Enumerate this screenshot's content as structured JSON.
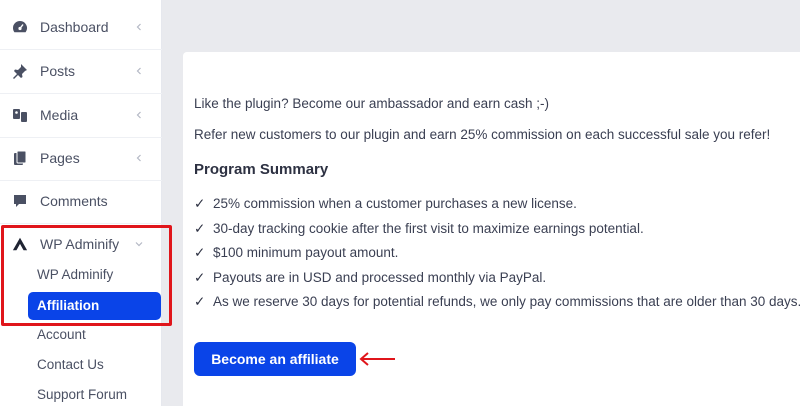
{
  "sidebar": {
    "items": [
      {
        "label": "Dashboard",
        "icon": "dashboard-icon"
      },
      {
        "label": "Posts",
        "icon": "pushpin-icon"
      },
      {
        "label": "Media",
        "icon": "media-icon"
      },
      {
        "label": "Pages",
        "icon": "pages-icon"
      },
      {
        "label": "Comments",
        "icon": "comment-icon"
      },
      {
        "label": "WP Adminify",
        "icon": "adminify-logo-icon"
      }
    ],
    "submenu": [
      "WP Adminify",
      "Affiliation",
      "Account",
      "Contact Us",
      "Support Forum"
    ],
    "active_submenu": "Affiliation"
  },
  "main": {
    "intro": "Like the plugin? Become our ambassador and earn cash ;-)",
    "refer": "Refer new customers to our plugin and earn 25% commission on each successful sale you refer!",
    "summary_title": "Program Summary",
    "bullets": [
      "25% commission when a customer purchases a new license.",
      "30-day tracking cookie after the first visit to maximize earnings potential.",
      "$100 minimum payout amount.",
      "Payouts are in USD and processed monthly via PayPal.",
      "As we reserve 30 days for potential refunds, we only pay commissions that are older than 30 days."
    ],
    "check_glyph": "✓",
    "cta_label": "Become an affiliate"
  },
  "colors": {
    "accent": "#0a44e8",
    "highlight": "#e0151b"
  }
}
